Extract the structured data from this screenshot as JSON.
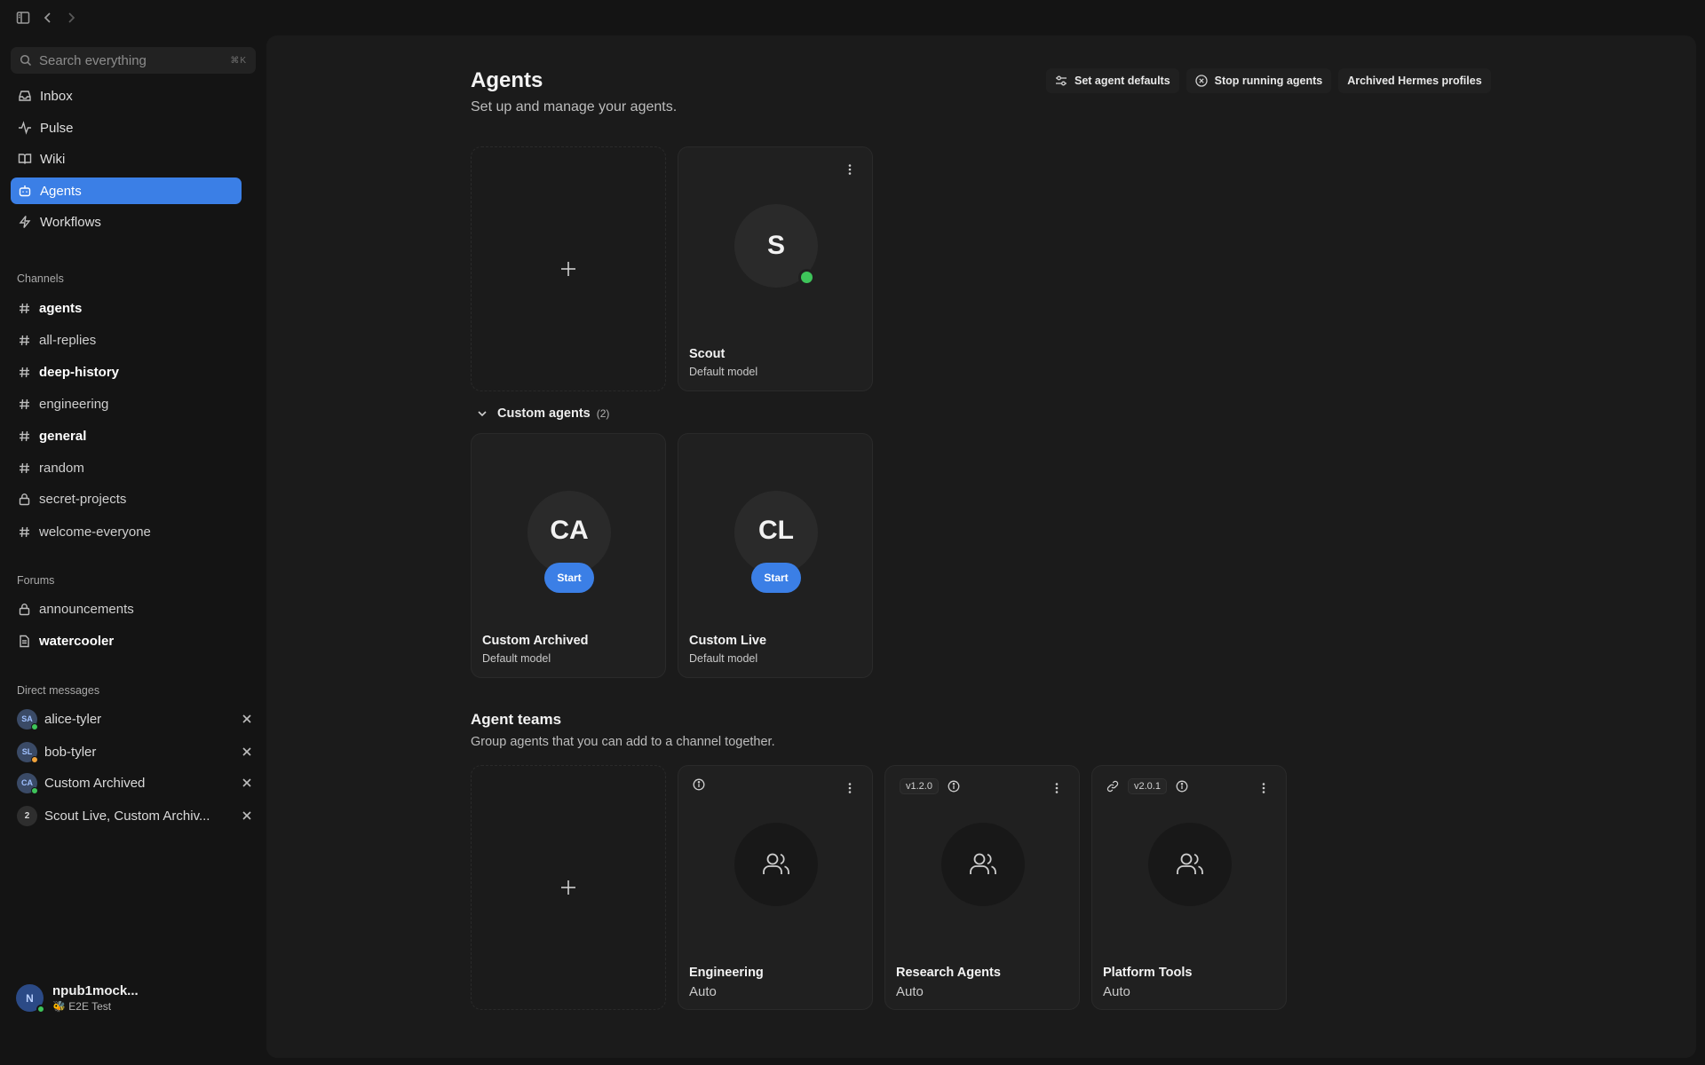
{
  "search": {
    "placeholder": "Search everything",
    "shortcut": "⌘K"
  },
  "nav": [
    {
      "label": "Inbox",
      "icon": "inbox-icon"
    },
    {
      "label": "Pulse",
      "icon": "activity-icon"
    },
    {
      "label": "Wiki",
      "icon": "book-icon"
    },
    {
      "label": "Agents",
      "icon": "bot-icon",
      "active": true
    },
    {
      "label": "Workflows",
      "icon": "zap-icon"
    }
  ],
  "channels": {
    "label": "Channels",
    "items": [
      {
        "label": "agents",
        "bold": true
      },
      {
        "label": "all-replies"
      },
      {
        "label": "deep-history",
        "bold": true
      },
      {
        "label": "engineering"
      },
      {
        "label": "general",
        "bold": true
      },
      {
        "label": "random"
      },
      {
        "label": "secret-projects",
        "private": true
      },
      {
        "label": "welcome-everyone"
      }
    ]
  },
  "forums": {
    "label": "Forums",
    "items": [
      {
        "label": "announcements",
        "private": true
      },
      {
        "label": "watercooler",
        "bold": true
      }
    ]
  },
  "dms": {
    "label": "Direct messages",
    "items": [
      {
        "initials": "SA",
        "label": "alice-tyler",
        "status_color": "#3ec45a"
      },
      {
        "initials": "SL",
        "label": "bob-tyler",
        "status_color": "#f0a23a"
      },
      {
        "initials": "CA",
        "label": "Custom Archived",
        "status_color": "#3ec45a"
      },
      {
        "initials": "2",
        "label": "Scout Live, Custom Archiv..."
      }
    ]
  },
  "user": {
    "initial": "N",
    "name": "npub1mock...",
    "status": "🐝 E2E Test"
  },
  "page": {
    "title": "Agents",
    "subtitle": "Set up and manage your agents.",
    "buttons": {
      "defaults": "Set agent defaults",
      "stop": "Stop running agents",
      "archived": "Archived Hermes profiles"
    }
  },
  "agents": [
    {
      "initials": "S",
      "name": "Scout",
      "model": "Default model",
      "online": true
    }
  ],
  "custom_group": {
    "label": "Custom agents",
    "count": "(2)",
    "agents": [
      {
        "initials": "CA",
        "name": "Custom Archived",
        "model": "Default model",
        "start_label": "Start"
      },
      {
        "initials": "CL",
        "name": "Custom Live",
        "model": "Default model",
        "start_label": "Start"
      }
    ]
  },
  "teams": {
    "title": "Agent teams",
    "subtitle": "Group agents that you can add to a channel together.",
    "items": [
      {
        "name": "Engineering",
        "model": "Auto"
      },
      {
        "name": "Research Agents",
        "model": "Auto",
        "version": "v1.2.0"
      },
      {
        "name": "Platform Tools",
        "model": "Auto",
        "version": "v2.0.1",
        "linked": true
      }
    ]
  },
  "colors": {
    "accent": "#3b7fe6",
    "online": "#3ec45a",
    "away": "#f0a23a"
  }
}
